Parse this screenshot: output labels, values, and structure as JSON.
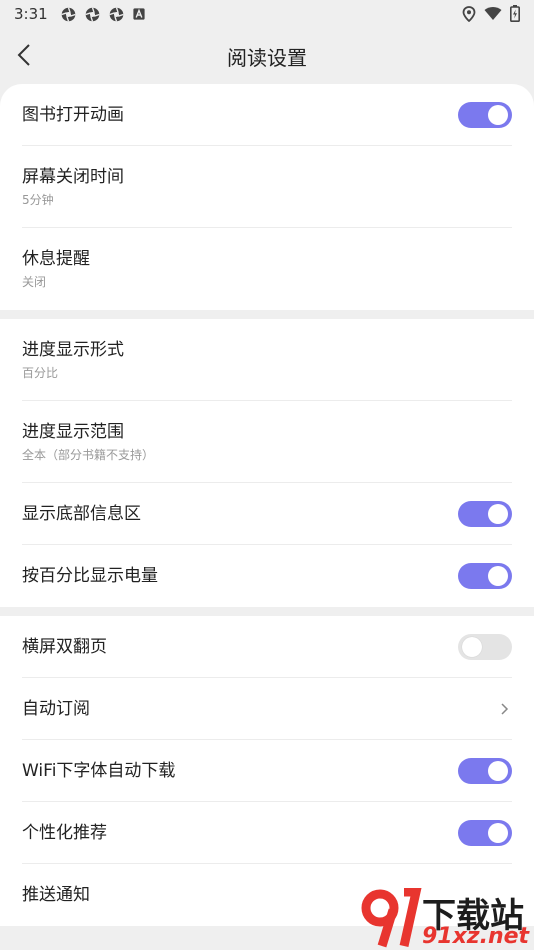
{
  "status_bar": {
    "time": "3:31"
  },
  "header": {
    "title": "阅读设置"
  },
  "groups": [
    {
      "rows": [
        {
          "label": "图书打开动画",
          "toggle": "on"
        },
        {
          "label": "屏幕关闭时间",
          "sub": "5分钟"
        },
        {
          "label": "休息提醒",
          "sub": "关闭"
        }
      ]
    },
    {
      "rows": [
        {
          "label": "进度显示形式",
          "sub": "百分比"
        },
        {
          "label": "进度显示范围",
          "sub": "全本（部分书籍不支持）"
        },
        {
          "label": "显示底部信息区",
          "toggle": "on"
        },
        {
          "label": "按百分比显示电量",
          "toggle": "on"
        }
      ]
    },
    {
      "rows": [
        {
          "label": "横屏双翻页",
          "toggle": "off"
        },
        {
          "label": "自动订阅",
          "action": "chevron-right-icon"
        },
        {
          "label": "WiFi下字体自动下载",
          "toggle": "on"
        },
        {
          "label": "个性化推荐",
          "toggle": "on"
        },
        {
          "label": "推送通知"
        }
      ]
    }
  ],
  "watermark": {
    "top": "下载站",
    "bottom": "91xz.net"
  },
  "colors": {
    "accent": "#7b79ee",
    "toggle_off": "#e4e4e4",
    "background": "#efefef",
    "watermark_red": "#e8352f"
  }
}
